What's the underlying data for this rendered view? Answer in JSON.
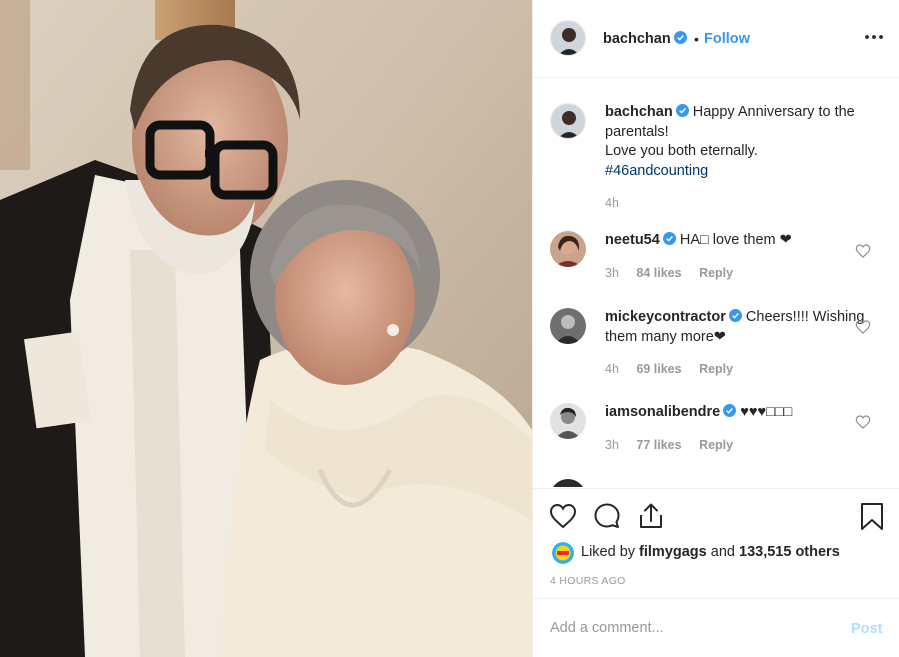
{
  "post": {
    "username": "bachchan",
    "dot": "•",
    "follow_label": "Follow",
    "more_icon": "more-horizontal-icon"
  },
  "caption": {
    "username": "bachchan",
    "line1": "Happy Anniversary to the parentals!",
    "line2": "Love you both eternally.",
    "hashtag": "#46andcounting",
    "time": "4h"
  },
  "comments": [
    {
      "username": "neetu54",
      "text": "HA□ love them ❤",
      "time": "3h",
      "likes": "84 likes",
      "reply": "Reply",
      "verified": true
    },
    {
      "username": "mickeycontractor",
      "text": "Cheers!!!! Wishing them many more❤",
      "time": "4h",
      "likes": "69 likes",
      "reply": "Reply",
      "verified": true
    },
    {
      "username": "iamsonalibendre",
      "text": "♥♥♥□□□",
      "time": "3h",
      "likes": "77 likes",
      "reply": "Reply",
      "verified": true
    }
  ],
  "likes": {
    "prefix": "Liked by",
    "liker": "filmygags",
    "and": "and",
    "others": "133,515 others"
  },
  "timestamp": "4 HOURS AGO",
  "add_comment": {
    "placeholder": "Add a comment...",
    "post_label": "Post"
  },
  "colors": {
    "accent": "#3897f0",
    "hashtag": "#003569",
    "muted": "#999999",
    "post_disabled": "#b3dbff",
    "border": "#efefef"
  }
}
